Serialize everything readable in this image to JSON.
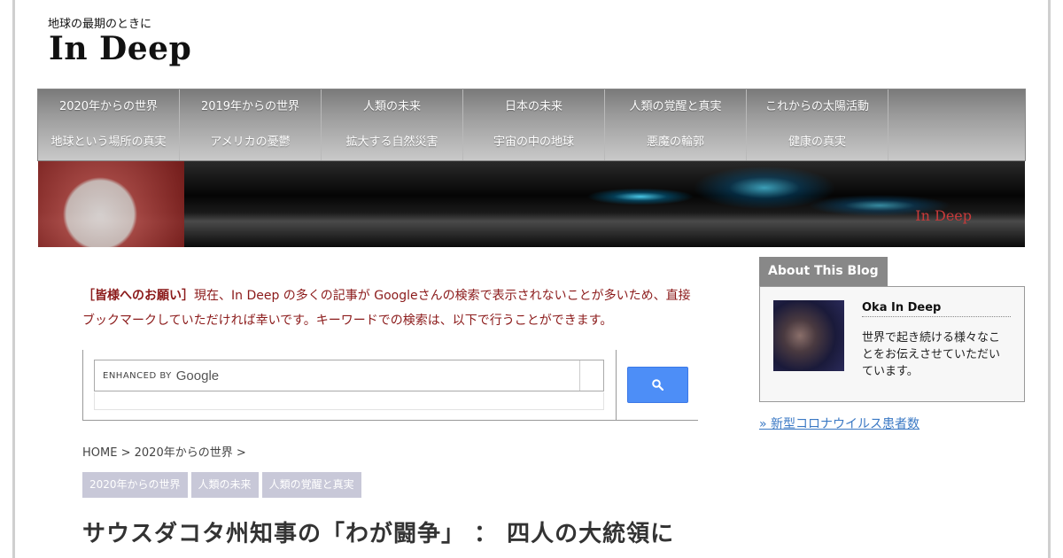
{
  "site": {
    "tagline": "地球の最期のときに",
    "title": "In Deep"
  },
  "nav": {
    "row1": [
      "2020年からの世界",
      "2019年からの世界",
      "人類の未来",
      "日本の未来",
      "人類の覚醒と真実",
      "これからの太陽活動"
    ],
    "row2": [
      "地球という場所の真実",
      "アメリカの憂鬱",
      "拡大する自然災害",
      "宇宙の中の地球",
      "悪魔の輪郭",
      "健康の真実"
    ]
  },
  "banner": {
    "title": "In Deep"
  },
  "notice": {
    "lead": "［皆様へのお願い］",
    "text": "現在、In Deep の多くの記事が Googleさんの検索で表示されないことが多いため、直接ブックマークしていただければ幸いです。キーワードでの検索は、以下で行うことができます。"
  },
  "search": {
    "enhanced_by": "ENHANCED BY",
    "google": "Google",
    "button_icon": "search-icon"
  },
  "breadcrumb": {
    "home": "HOME",
    "sep": ">",
    "category": "2020年からの世界"
  },
  "tags": [
    "2020年からの世界",
    "人類の未来",
    "人類の覚醒と真実"
  ],
  "post": {
    "title": "サウスダコタ州知事の「わが闘争」 ： 四人の大統領に"
  },
  "sidebar": {
    "tab": "About This Blog",
    "name": "Oka In Deep",
    "desc": "世界で起き続ける様々なことをお伝えさせていただいています。",
    "link": "» 新型コロナウイルス患者数"
  },
  "colors": {
    "notice": "#8b1a1a",
    "search_button": "#4d8ef7",
    "tag_bg": "#c8c8d8",
    "link": "#3a78c4"
  }
}
